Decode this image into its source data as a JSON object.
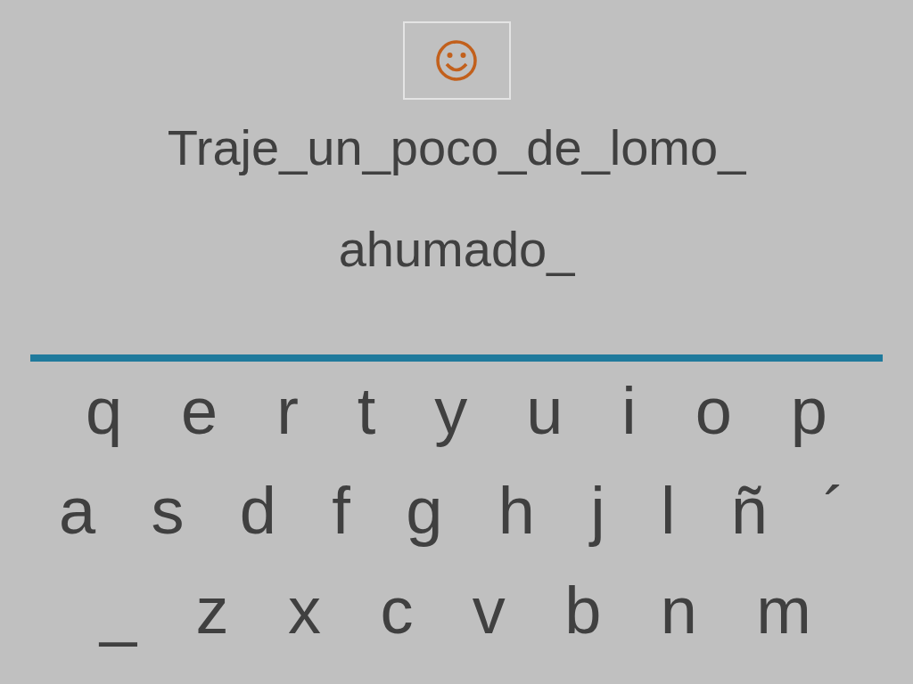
{
  "sentence_lines": [
    "Traje_un_poco_de_lomo_",
    "ahumado_"
  ],
  "keyboard": {
    "rows": [
      [
        "q",
        "e",
        "r",
        "t",
        "y",
        "u",
        "i",
        "o",
        "p"
      ],
      [
        "a",
        "s",
        "d",
        "f",
        "g",
        "h",
        "j",
        "l",
        "ñ",
        "´"
      ],
      [
        "_",
        "z",
        "x",
        "c",
        "v",
        "b",
        "n",
        "m"
      ]
    ]
  }
}
